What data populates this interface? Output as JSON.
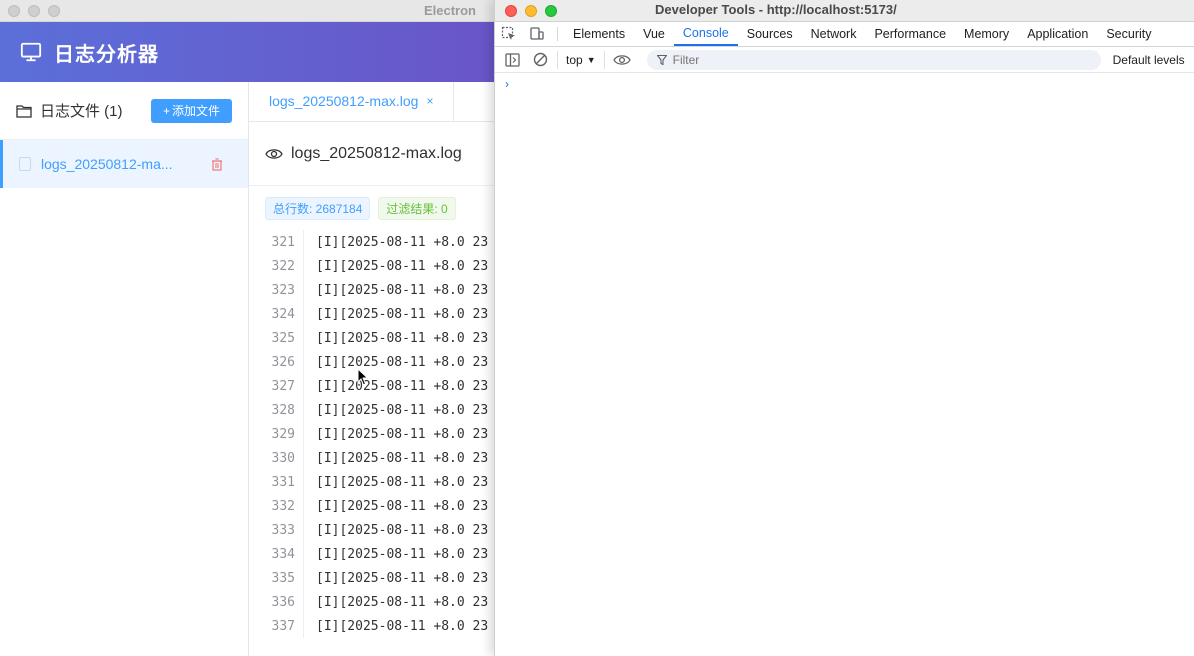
{
  "app": {
    "window_title": "Electron",
    "header_title": "日志分析器",
    "sidebar": {
      "title": "日志文件 (1)",
      "add_button": "添加文件",
      "file_name": "logs_20250812-ma..."
    },
    "tab": {
      "label": "logs_20250812-max.log",
      "close": "×"
    },
    "viewer": {
      "file_name": "logs_20250812-max.log",
      "total_lines": "总行数: 2687184",
      "filter_result": "过滤结果: 0"
    },
    "log_rows": [
      {
        "line": "321",
        "text": "[I][2025-08-11 +8.0 23"
      },
      {
        "line": "322",
        "text": "[I][2025-08-11 +8.0 23"
      },
      {
        "line": "323",
        "text": "[I][2025-08-11 +8.0 23"
      },
      {
        "line": "324",
        "text": "[I][2025-08-11 +8.0 23"
      },
      {
        "line": "325",
        "text": "[I][2025-08-11 +8.0 23"
      },
      {
        "line": "326",
        "text": "[I][2025-08-11 +8.0 23"
      },
      {
        "line": "327",
        "text": "[I][2025-08-11 +8.0 23"
      },
      {
        "line": "328",
        "text": "[I][2025-08-11 +8.0 23"
      },
      {
        "line": "329",
        "text": "[I][2025-08-11 +8.0 23"
      },
      {
        "line": "330",
        "text": "[I][2025-08-11 +8.0 23"
      },
      {
        "line": "331",
        "text": "[I][2025-08-11 +8.0 23"
      },
      {
        "line": "332",
        "text": "[I][2025-08-11 +8.0 23"
      },
      {
        "line": "333",
        "text": "[I][2025-08-11 +8.0 23"
      },
      {
        "line": "334",
        "text": "[I][2025-08-11 +8.0 23"
      },
      {
        "line": "335",
        "text": "[I][2025-08-11 +8.0 23"
      },
      {
        "line": "336",
        "text": "[I][2025-08-11 +8.0 23"
      },
      {
        "line": "337",
        "text": "[I][2025-08-11 +8.0 23"
      }
    ]
  },
  "devtools": {
    "window_title": "Developer Tools - http://localhost:5173/",
    "tabs": [
      "Elements",
      "Vue",
      "Console",
      "Sources",
      "Network",
      "Performance",
      "Memory",
      "Application",
      "Security"
    ],
    "active_tab": "Console",
    "context": "top",
    "filter_placeholder": "Filter",
    "levels": "Default levels",
    "prompt": "›"
  },
  "colors": {
    "header_gradient_start": "#5b6fd9",
    "header_gradient_end": "#6a55c8",
    "primary": "#409eff",
    "success": "#67c23a",
    "devtools_accent": "#1a73e8"
  }
}
